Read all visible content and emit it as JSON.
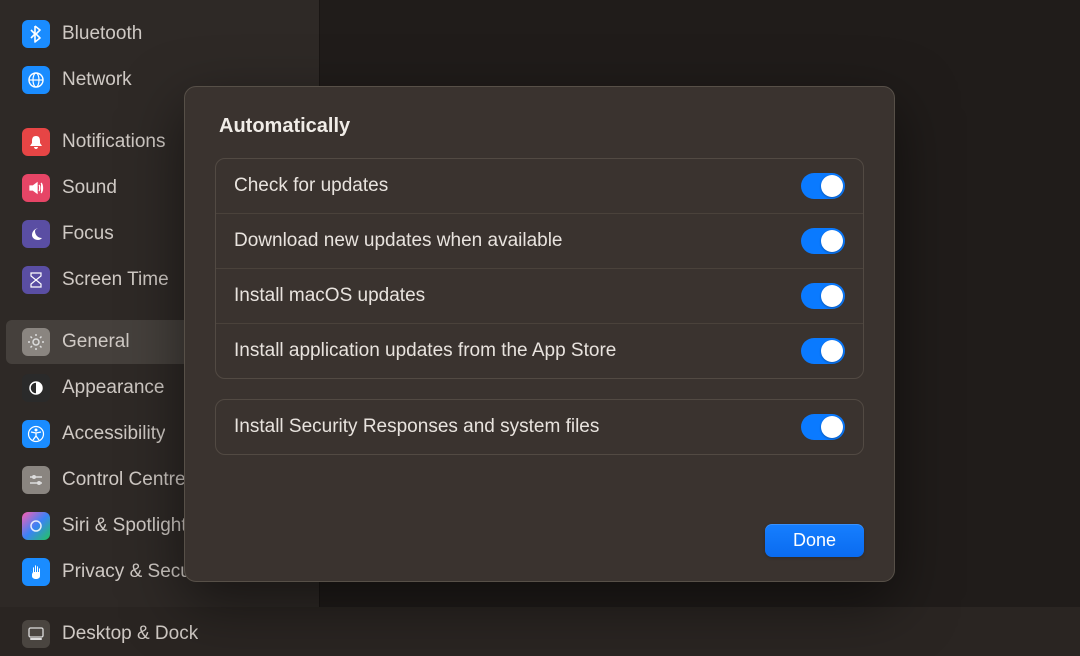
{
  "sidebar": {
    "items": [
      {
        "label": "Bluetooth"
      },
      {
        "label": "Network"
      },
      {
        "label": "Notifications"
      },
      {
        "label": "Sound"
      },
      {
        "label": "Focus"
      },
      {
        "label": "Screen Time"
      },
      {
        "label": "General"
      },
      {
        "label": "Appearance"
      },
      {
        "label": "Accessibility"
      },
      {
        "label": "Control Centre"
      },
      {
        "label": "Siri & Spotlight"
      },
      {
        "label": "Privacy & Security"
      },
      {
        "label": "Desktop & Dock"
      }
    ]
  },
  "dialog": {
    "title": "Automatically",
    "group1": [
      {
        "label": "Check for updates",
        "on": true
      },
      {
        "label": "Download new updates when available",
        "on": true
      },
      {
        "label": "Install macOS updates",
        "on": true
      },
      {
        "label": "Install application updates from the App Store",
        "on": true
      }
    ],
    "group2": [
      {
        "label": "Install Security Responses and system files",
        "on": true
      }
    ],
    "done": "Done"
  }
}
